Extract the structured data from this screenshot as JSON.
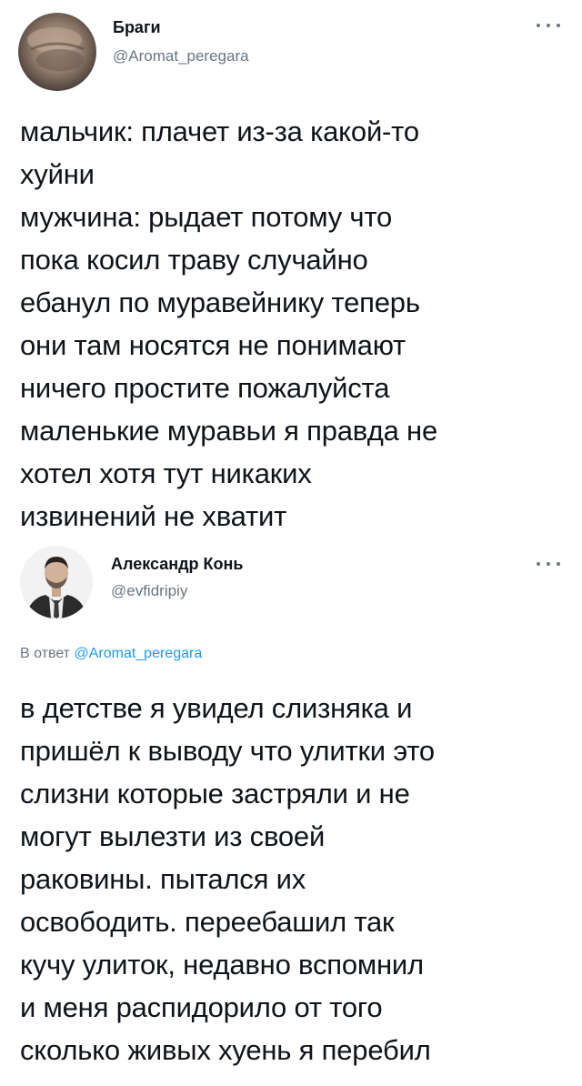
{
  "tweets": [
    {
      "author_name": "Браги",
      "author_handle": "@Aromat_peregara",
      "lines": [
        "мальчик: плачет из-за какой-то",
        "хуйни",
        "мужчина: рыдает потому что",
        "пока косил траву случайно",
        "ебанул по муравейнику теперь",
        "они там носятся не понимают",
        "ничего простите пожалуйста",
        "маленькие муравьи я правда не",
        "хотел хотя тут никаких",
        "извинений не хватит"
      ]
    },
    {
      "author_name": "Александр Конь",
      "author_handle": "@evfidripiy",
      "reply_prefix": "В ответ",
      "reply_handle": "@Aromat_peregara",
      "lines": [
        "в детстве я увидел слизняка и",
        "пришёл к выводу что улитки это",
        "слизни которые застряли и не",
        "могут вылезти из своей",
        "раковины. пытался их",
        "освободить. переебашил так",
        "кучу улиток, недавно вспомнил",
        "и меня распидорило от того",
        "сколько живых хуень я перебил"
      ]
    }
  ],
  "icons": {
    "more": "more-horizontal-icon"
  },
  "colors": {
    "text": "#0f1419",
    "secondary": "#6b7580",
    "link": "#1d9bf0"
  }
}
